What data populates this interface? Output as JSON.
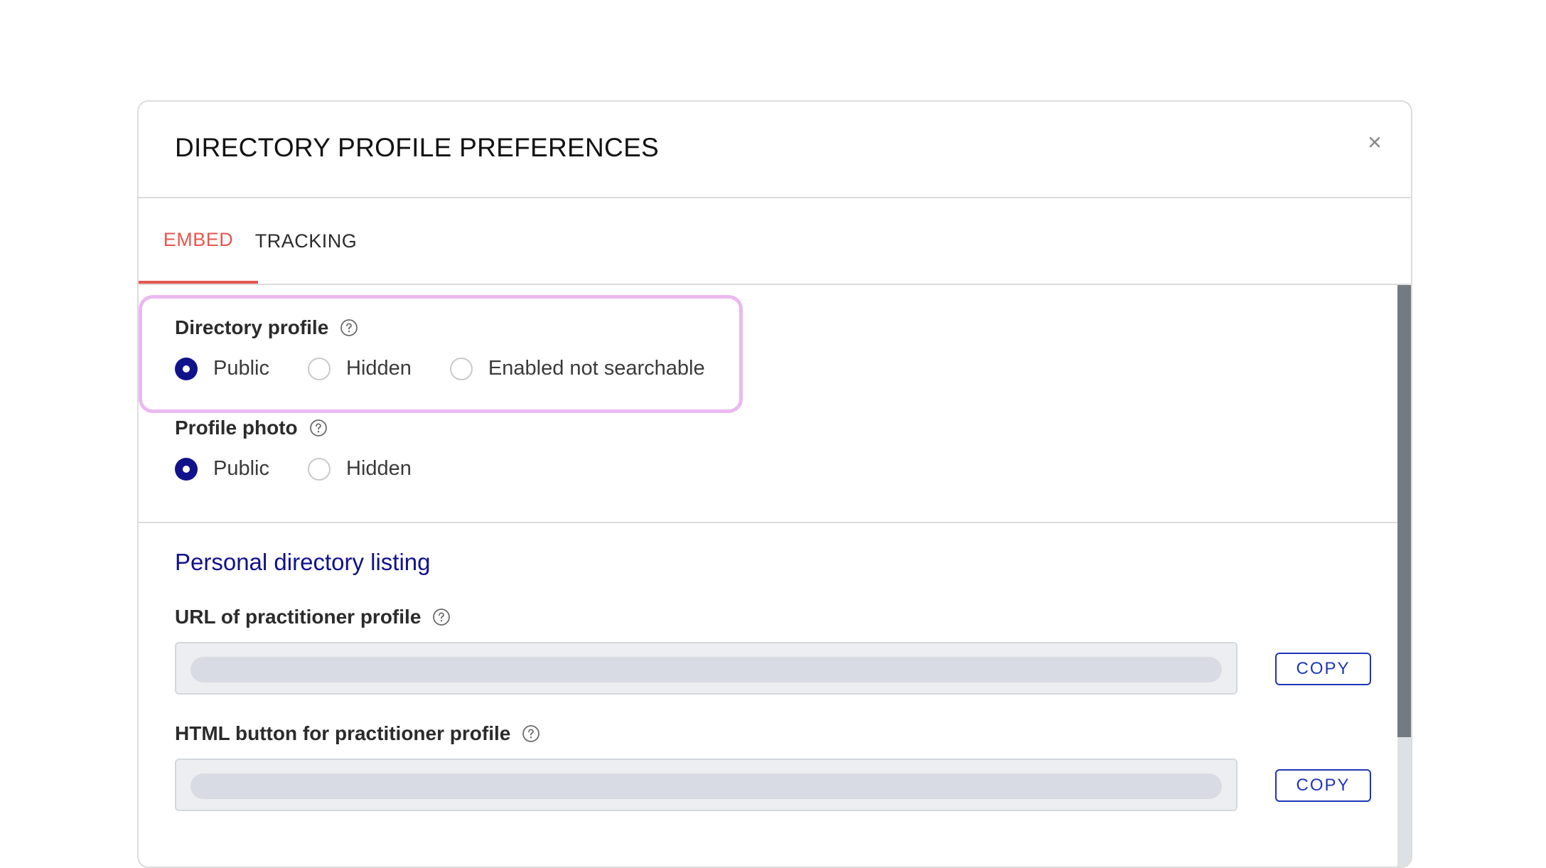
{
  "modal": {
    "title": "DIRECTORY PROFILE PREFERENCES",
    "close_icon": "close-icon"
  },
  "tabs": [
    {
      "label": "EMBED",
      "active": true
    },
    {
      "label": "TRACKING",
      "active": false
    }
  ],
  "directory_profile": {
    "label": "Directory profile",
    "help_icon": "help-circle-icon",
    "options": [
      {
        "label": "Public",
        "checked": true
      },
      {
        "label": "Hidden",
        "checked": false
      },
      {
        "label": "Enabled not searchable",
        "checked": false
      }
    ]
  },
  "profile_photo": {
    "label": "Profile photo",
    "help_icon": "help-circle-icon",
    "options": [
      {
        "label": "Public",
        "checked": true
      },
      {
        "label": "Hidden",
        "checked": false
      }
    ]
  },
  "personal_listing": {
    "title": "Personal directory listing",
    "url_field": {
      "label": "URL of practitioner profile",
      "value": "",
      "copy_label": "COPY"
    },
    "html_field": {
      "label": "HTML button for practitioner profile",
      "value": "",
      "copy_label": "COPY"
    }
  },
  "colors": {
    "accent_tab": "#e8564f",
    "primary": "#10128c",
    "button_blue": "#1f36b8",
    "highlight": "#eab9ef"
  }
}
